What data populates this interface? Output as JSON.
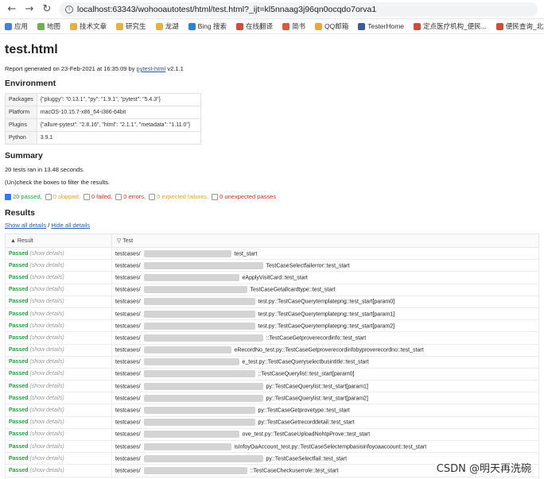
{
  "browser": {
    "url": "localhost:63343/wohooautotest/html/test.html?_ijt=kl5nnaag3j96qn0ocqdo7orva1",
    "bookmarks": [
      {
        "label": "应用",
        "color": "#4a7de0"
      },
      {
        "label": "地图",
        "color": "#6fae58"
      },
      {
        "label": "技术文章",
        "color": "#e5b33a"
      },
      {
        "label": "研究生",
        "color": "#e5b33a"
      },
      {
        "label": "龙湖",
        "color": "#e5b33a"
      },
      {
        "label": "Bing 搜索",
        "color": "#2b82d9"
      },
      {
        "label": "在线翻译",
        "color": "#d54b3b"
      },
      {
        "label": "简书",
        "color": "#e0553f"
      },
      {
        "label": "QQ邮箱",
        "color": "#e8a93a"
      },
      {
        "label": "TesterHome",
        "color": "#3b5b9b"
      },
      {
        "label": "定点医疗机构_便民...",
        "color": "#d54b3b"
      },
      {
        "label": "便民查询_北京市医...",
        "color": "#d54b3b"
      }
    ]
  },
  "report": {
    "title": "test.html",
    "generated_prefix": "Report generated on 23-Feb-2021 at 16:35:09 by ",
    "generator_link": "pytest-html",
    "generator_version": " v2.1.1",
    "environment_heading": "Environment",
    "environment": [
      {
        "key": "Packages",
        "value": "{\"pluggy\": \"0.13.1\", \"py\": \"1.9.1\", \"pytest\": \"5.4.3\"}"
      },
      {
        "key": "Platform",
        "value": "macOS-10.15.7-x86_64-i386-64bit"
      },
      {
        "key": "Plugins",
        "value": "{\"allure-pytest\": \"2.8.16\", \"html\": \"2.1.1\", \"metadata\": \"1.11.0\"}"
      },
      {
        "key": "Python",
        "value": "3.9.1"
      }
    ],
    "summary_heading": "Summary",
    "summary_text": "20 tests ran in 13.48 seconds.",
    "filter_hint": "(Un)check the boxes to filter the results.",
    "filters": [
      {
        "label": "20 passed,",
        "checked": true,
        "color": "#23a23f"
      },
      {
        "label": "0 skipped,",
        "checked": false,
        "color": "#e5a22b"
      },
      {
        "label": "0 failed,",
        "checked": false,
        "color": "#d9301e"
      },
      {
        "label": "0 errors,",
        "checked": false,
        "color": "#d9301e"
      },
      {
        "label": "0 expected failures,",
        "checked": false,
        "color": "#e5a22b"
      },
      {
        "label": "0 unexpected passes",
        "checked": false,
        "color": "#d9301e"
      }
    ],
    "results_heading": "Results",
    "show_all": "Show all details",
    "separator": " / ",
    "hide_all": "Hide all details",
    "col_result": "Result",
    "col_test": "Test",
    "passed_label": "Passed",
    "details_label": "(show details)",
    "rows": [
      {
        "prefix": "testcases/",
        "suffix": "test_start"
      },
      {
        "prefix": "testcases/",
        "suffix": "TestCaseSelectfailerror::test_start"
      },
      {
        "prefix": "testcases/",
        "suffix": "eApplyVisitCard::test_start"
      },
      {
        "prefix": "testcases/",
        "suffix": "TestCaseGetallcardtype::test_start"
      },
      {
        "prefix": "testcases/",
        "suffix": "test.py::TestCaseQuerytemplatepng::test_start[param0]"
      },
      {
        "prefix": "testcases/",
        "suffix": "test.py::TestCaseQuerytemplatepng::test_start[param1]"
      },
      {
        "prefix": "testcases/",
        "suffix": "test.py::TestCaseQuerytemplatepng::test_start[param2]"
      },
      {
        "prefix": "testcases/",
        "suffix": "::TestCaseGetproverecordinfo::test_start"
      },
      {
        "prefix": "testcases/",
        "suffix": "eRecordNo_test.py::TestCaseGetproverecordinfobyproverecordno::test_start"
      },
      {
        "prefix": "testcases/",
        "suffix": "e_test.py::TestCaseQueryselectbusintitle::test_start"
      },
      {
        "prefix": "testcases/",
        "suffix": "::TestCaseQuerylist::test_start[param0]"
      },
      {
        "prefix": "testcases/",
        "suffix": "py::TestCaseQuerylist::test_start[param1]"
      },
      {
        "prefix": "testcases/",
        "suffix": "py::TestCaseQuerylist::test_start[param2]"
      },
      {
        "prefix": "testcases/",
        "suffix": "py::TestCaseGetprovetype::test_start"
      },
      {
        "prefix": "testcases/",
        "suffix": "py::TestCaseGetrecorddetail::test_start"
      },
      {
        "prefix": "testcases/",
        "suffix": "ove_test.py::TestCaseUploadNohtpProve::test_start"
      },
      {
        "prefix": "testcases/",
        "suffix": "isInfoyOaAccount_test.py::TestCaseSelectempbasisinfoyoaaccount::test_start"
      },
      {
        "prefix": "testcases/",
        "suffix": "py::TestCaseSelectfail::test_start"
      },
      {
        "prefix": "testcases/",
        "suffix": "::TestCaseCheckuserrole::test_start"
      },
      {
        "prefix": "testcases/",
        "suffix": "::TestCaseQuerysiontype::test_start"
      }
    ]
  },
  "watermark": "CSDN @明天再洗碗"
}
